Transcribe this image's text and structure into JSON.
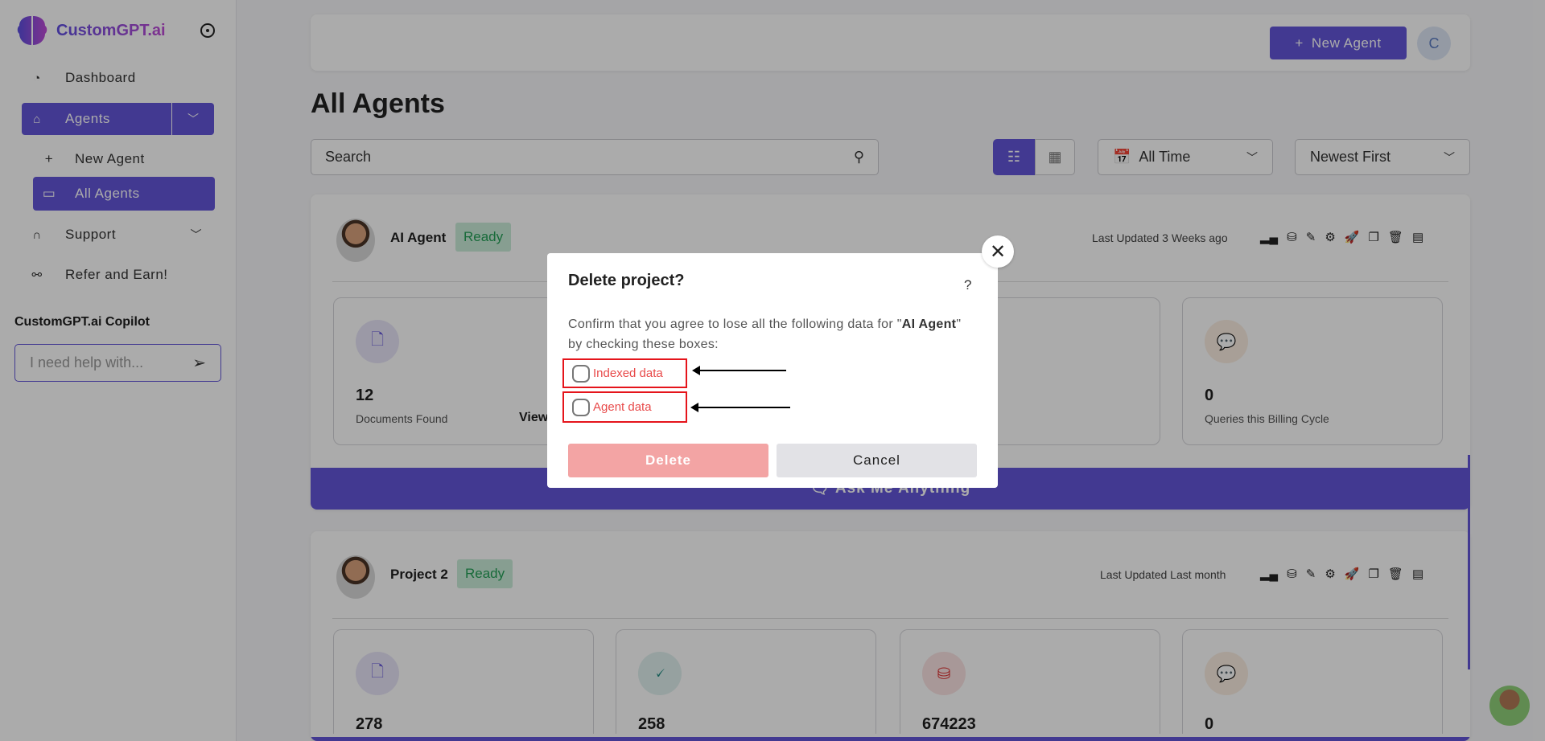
{
  "brand": {
    "name": "CustomGPT.ai"
  },
  "sidebar": {
    "items": [
      {
        "label": "Dashboard",
        "icon": "gauge-icon"
      },
      {
        "label": "Agents",
        "icon": "agent-icon"
      },
      {
        "label": "New Agent",
        "icon": "plus-icon"
      },
      {
        "label": "All Agents",
        "icon": "folder-icon"
      },
      {
        "label": "Support",
        "icon": "headphones-icon"
      },
      {
        "label": "Refer and Earn!",
        "icon": "share-icon"
      }
    ],
    "copilot_title": "CustomGPT.ai Copilot",
    "copilot_placeholder": "I need help with..."
  },
  "header": {
    "new_agent": "New Agent",
    "avatar_initial": "C"
  },
  "page": {
    "title": "All Agents",
    "search_placeholder": "Search",
    "time_filter": "All Time",
    "sort": "Newest First"
  },
  "agents": [
    {
      "name": "AI Agent",
      "status": "Ready",
      "updated": "Last Updated 3 Weeks ago",
      "stats": [
        {
          "value": "12",
          "label": "Documents Found",
          "link": "View"
        },
        {
          "value": "0",
          "label": "Queries this Billing Cycle"
        }
      ],
      "ask": "Ask Me Anything"
    },
    {
      "name": "Project 2",
      "status": "Ready",
      "updated": "Last Updated Last month",
      "stats": [
        {
          "value": "278"
        },
        {
          "value": "258"
        },
        {
          "value": "674223"
        },
        {
          "value": "0"
        }
      ]
    }
  ],
  "modal": {
    "title": "Delete project?",
    "help": "?",
    "text_pre": "Confirm that you agree to lose all the following data for \"",
    "agent_name": "AI Agent",
    "text_post": "\" by checking these boxes:",
    "options": [
      "Indexed data",
      "Agent data"
    ],
    "delete": "Delete",
    "cancel": "Cancel"
  },
  "colors": {
    "accent": "#6355d8",
    "danger": "#e5141b",
    "ready": "#24a057"
  }
}
